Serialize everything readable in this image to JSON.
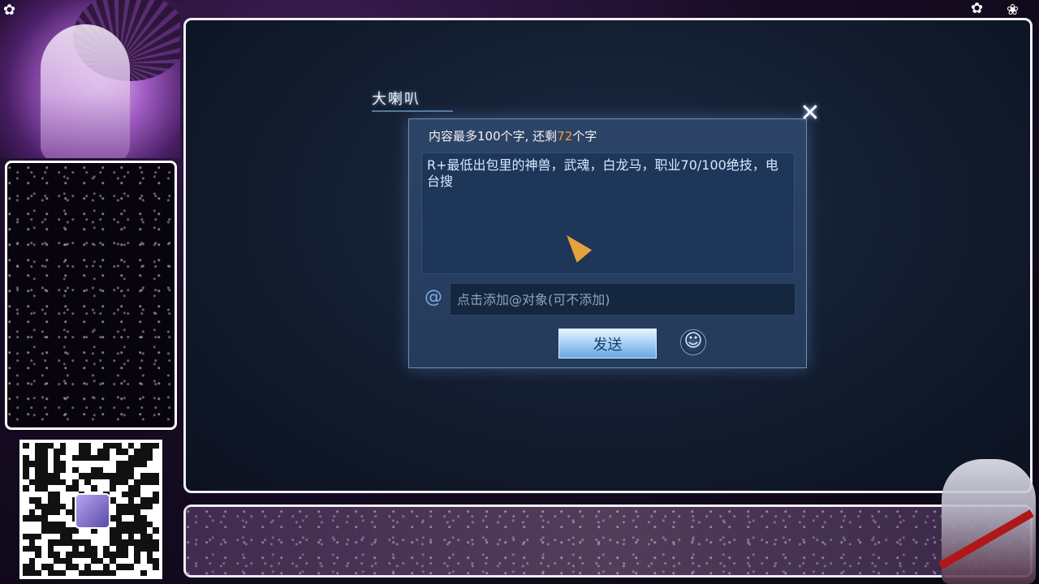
{
  "dialog": {
    "tab_title": "大喇叭",
    "char_limit": {
      "prefix": "内容最多100个字, 还剩",
      "remaining": "72",
      "suffix": "个字"
    },
    "message": "R+最低出包里的神兽，武魂，白龙马，职业70/100绝技，电台搜",
    "mention_placeholder": "点击添加@对象(可不添加)",
    "at_symbol": "@",
    "send_label": "发送",
    "close_icon": "close-icon",
    "emoji_icon": "smiley-icon"
  },
  "colors": {
    "remaining_count": "#f0a040",
    "dialog_bg": "#243b5c",
    "send_button": "#a9d2f7"
  }
}
